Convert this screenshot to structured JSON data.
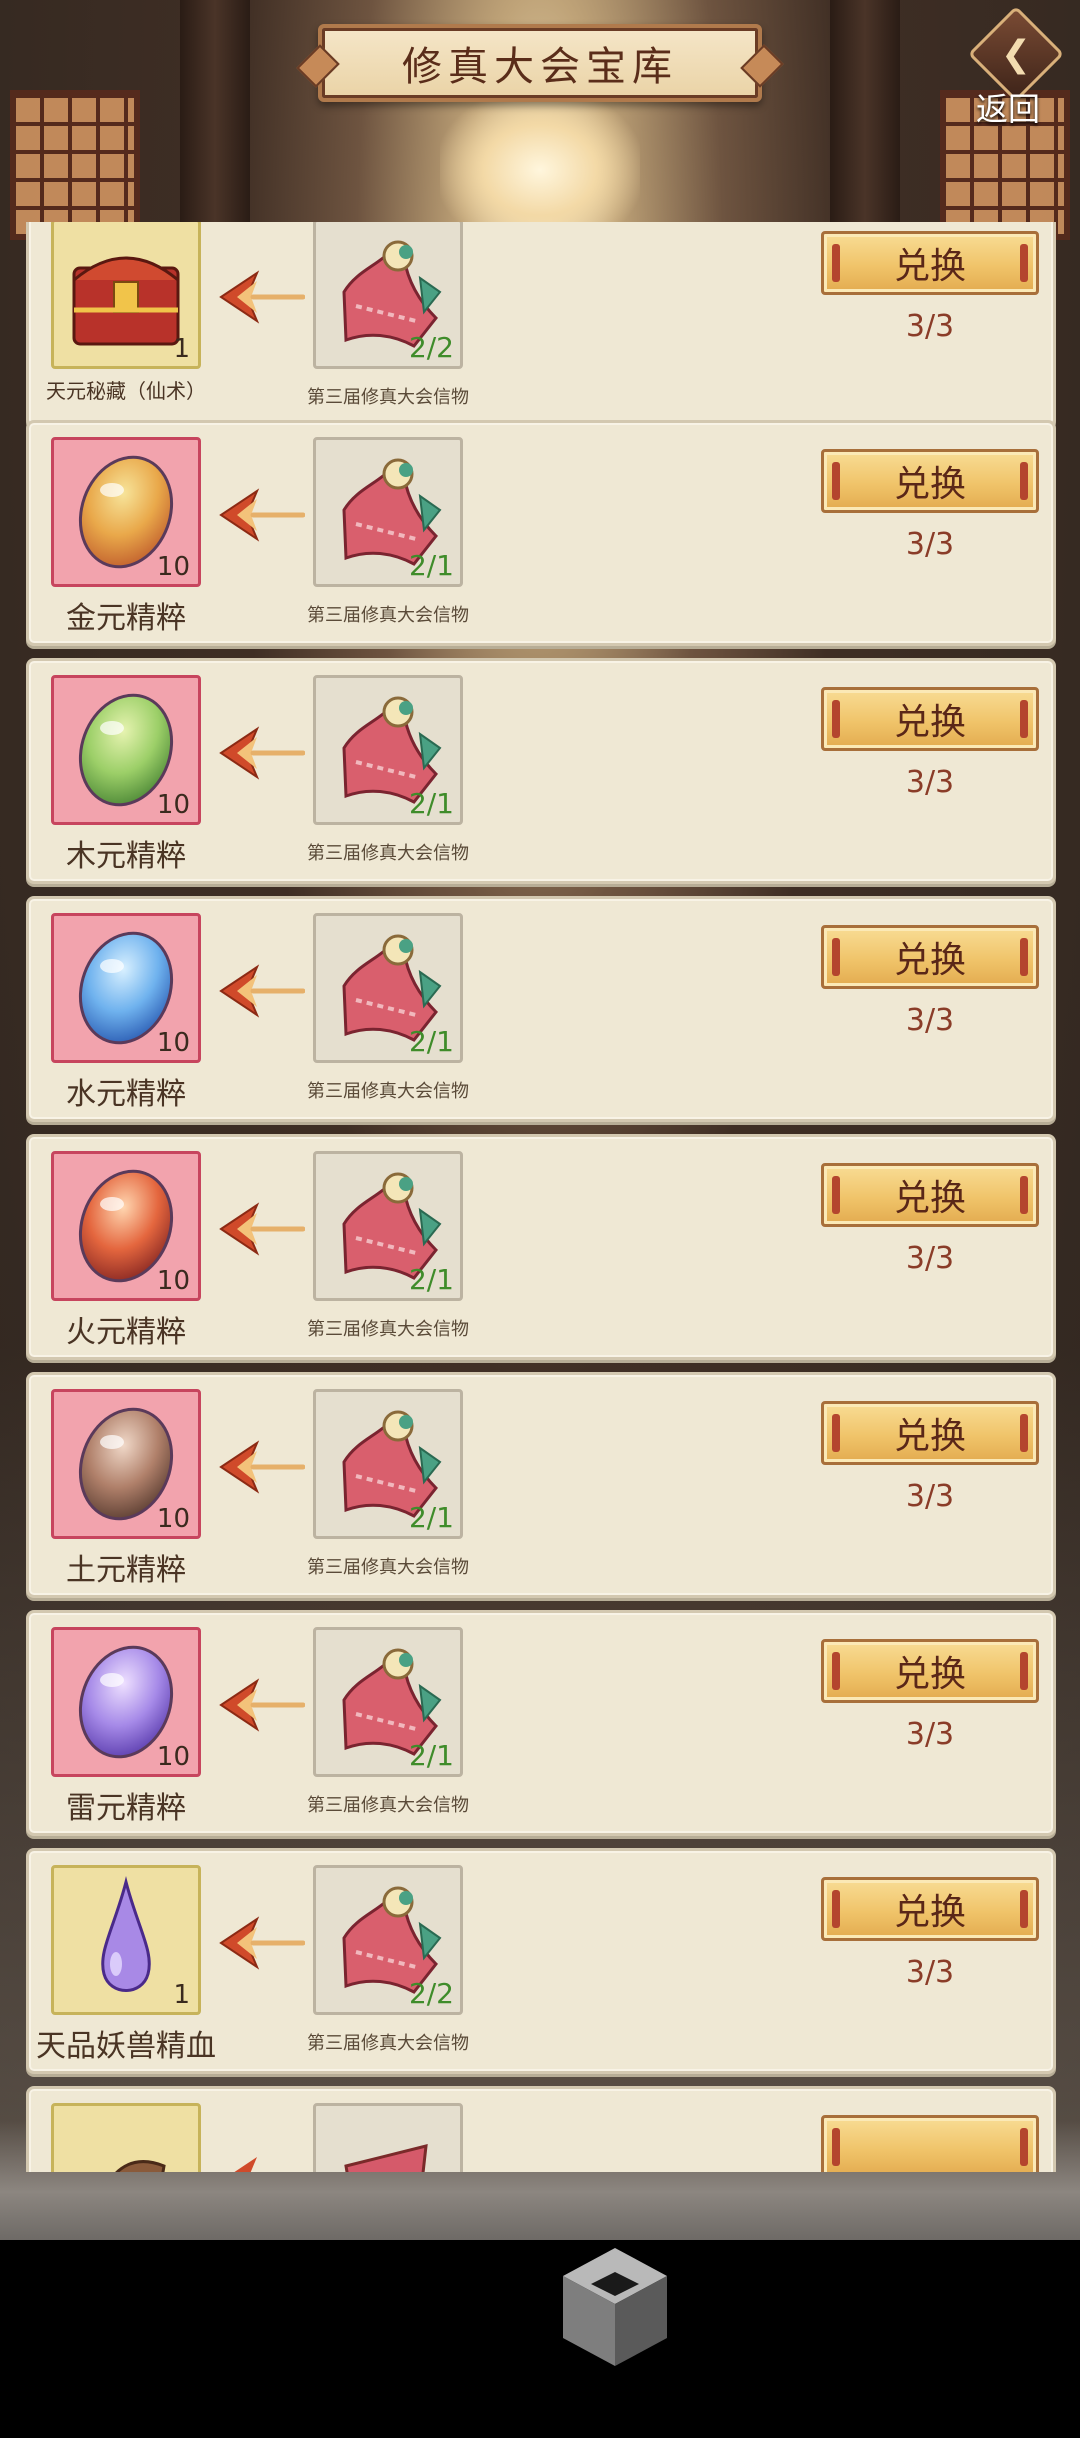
{
  "header": {
    "title": "修真大会宝库",
    "back_label": "返回"
  },
  "colors": {
    "button_gold": "#f0c46a",
    "limit_red": "#8a3c28",
    "count_green": "#3f8c2a",
    "essence_slot_pink": "#f2a3ad",
    "common_slot_yellow": "#efe0a3"
  },
  "items": [
    {
      "reward_name": "天元秘藏（仙术）",
      "reward_count": "1",
      "reward_icon": "treasure-chest-icon",
      "cost_name": "第三届修真大会信物",
      "cost_count": "2/2",
      "button": "兑换",
      "limit": "3/3"
    },
    {
      "reward_name": "金元精粹",
      "reward_count": "10",
      "reward_icon": "gold-essence-icon",
      "cost_name": "第三届修真大会信物",
      "cost_count": "2/1",
      "button": "兑换",
      "limit": "3/3"
    },
    {
      "reward_name": "木元精粹",
      "reward_count": "10",
      "reward_icon": "wood-essence-icon",
      "cost_name": "第三届修真大会信物",
      "cost_count": "2/1",
      "button": "兑换",
      "limit": "3/3"
    },
    {
      "reward_name": "水元精粹",
      "reward_count": "10",
      "reward_icon": "water-essence-icon",
      "cost_name": "第三届修真大会信物",
      "cost_count": "2/1",
      "button": "兑换",
      "limit": "3/3"
    },
    {
      "reward_name": "火元精粹",
      "reward_count": "10",
      "reward_icon": "fire-essence-icon",
      "cost_name": "第三届修真大会信物",
      "cost_count": "2/1",
      "button": "兑换",
      "limit": "3/3"
    },
    {
      "reward_name": "土元精粹",
      "reward_count": "10",
      "reward_icon": "earth-essence-icon",
      "cost_name": "第三届修真大会信物",
      "cost_count": "2/1",
      "button": "兑换",
      "limit": "3/3"
    },
    {
      "reward_name": "雷元精粹",
      "reward_count": "10",
      "reward_icon": "thunder-essence-icon",
      "cost_name": "第三届修真大会信物",
      "cost_count": "2/1",
      "button": "兑换",
      "limit": "3/3"
    },
    {
      "reward_name": "天品妖兽精血",
      "reward_count": "1",
      "reward_icon": "beast-blood-drop-icon",
      "cost_name": "第三届修真大会信物",
      "cost_count": "2/2",
      "button": "兑换",
      "limit": "3/3"
    }
  ],
  "partial_item": {
    "reward_icon": "scroll-item-icon",
    "cost_icon": "token-flag-icon"
  },
  "navbar": {
    "icon": "cube-icon"
  }
}
